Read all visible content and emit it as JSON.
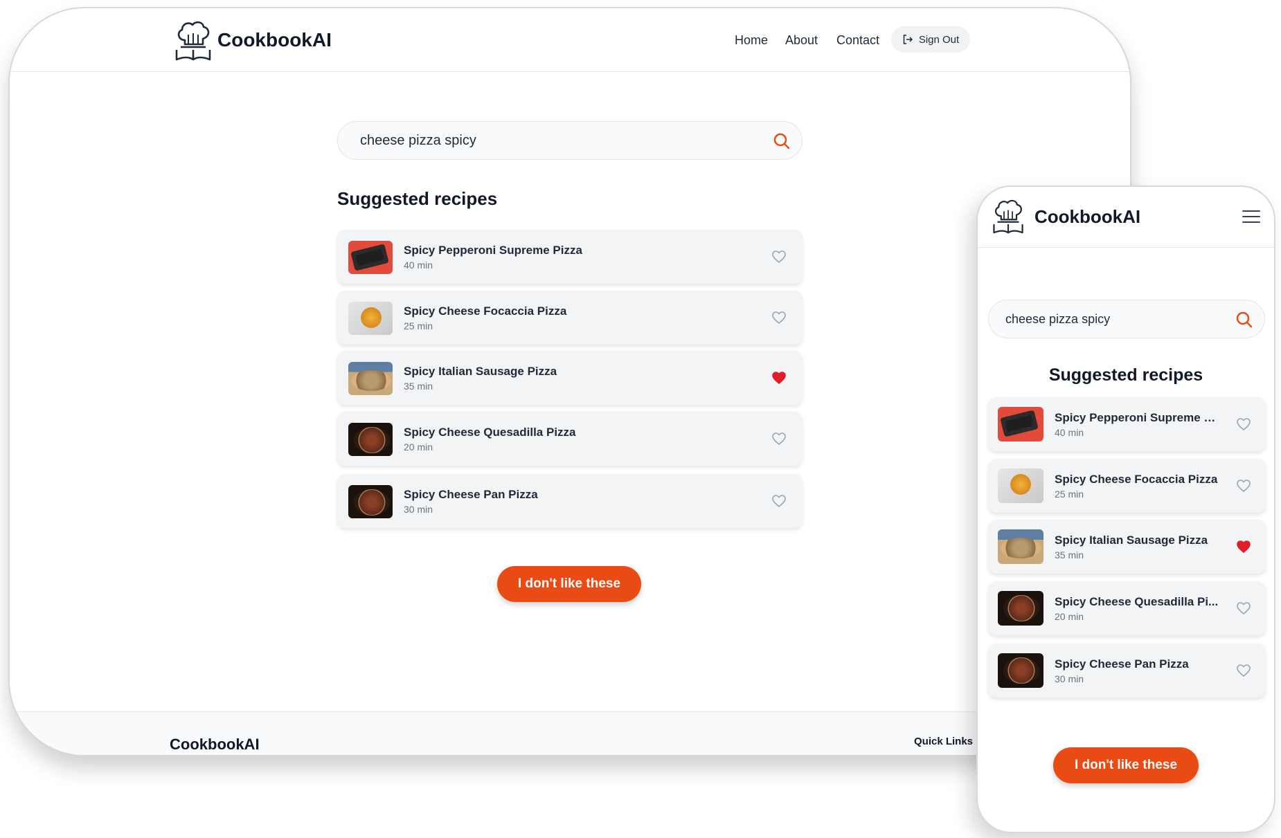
{
  "brand": "CookbookAI",
  "nav": {
    "home": "Home",
    "about": "About",
    "contact": "Contact",
    "sign_out": "Sign Out"
  },
  "search": {
    "query": "cheese pizza spicy"
  },
  "heading": "Suggested recipes",
  "recipes": [
    {
      "title": "Spicy Pepperoni Supreme Pizza",
      "mobile_title": "Spicy Pepperoni Supreme Pi...",
      "time": "40 min",
      "favorited": false,
      "thumb": "pepperoni"
    },
    {
      "title": "Spicy Cheese Focaccia Pizza",
      "mobile_title": "Spicy Cheese Focaccia Pizza",
      "time": "25 min",
      "favorited": false,
      "thumb": "focaccia"
    },
    {
      "title": "Spicy Italian Sausage Pizza",
      "mobile_title": "Spicy Italian Sausage Pizza",
      "time": "35 min",
      "favorited": true,
      "thumb": "sausage"
    },
    {
      "title": "Spicy Cheese Quesadilla Pizza",
      "mobile_title": "Spicy Cheese Quesadilla Pi...",
      "time": "20 min",
      "favorited": false,
      "thumb": "dark"
    },
    {
      "title": "Spicy Cheese Pan Pizza",
      "mobile_title": "Spicy Cheese Pan Pizza",
      "time": "30 min",
      "favorited": false,
      "thumb": "dark"
    }
  ],
  "dislike_button": "I don't like these",
  "footer": {
    "brand": "CookbookAI",
    "quick_links": "Quick Links"
  },
  "colors": {
    "accent": "#ea4b14",
    "heart_active": "#e11d2a",
    "heart_inactive": "#9ca3af",
    "card_bg": "#f3f4f6"
  },
  "icons": {
    "logo": "chef-hat-book-icon",
    "search": "search-icon",
    "sign_out": "sign-out-icon",
    "heart": "heart-icon",
    "menu": "hamburger-menu-icon"
  }
}
